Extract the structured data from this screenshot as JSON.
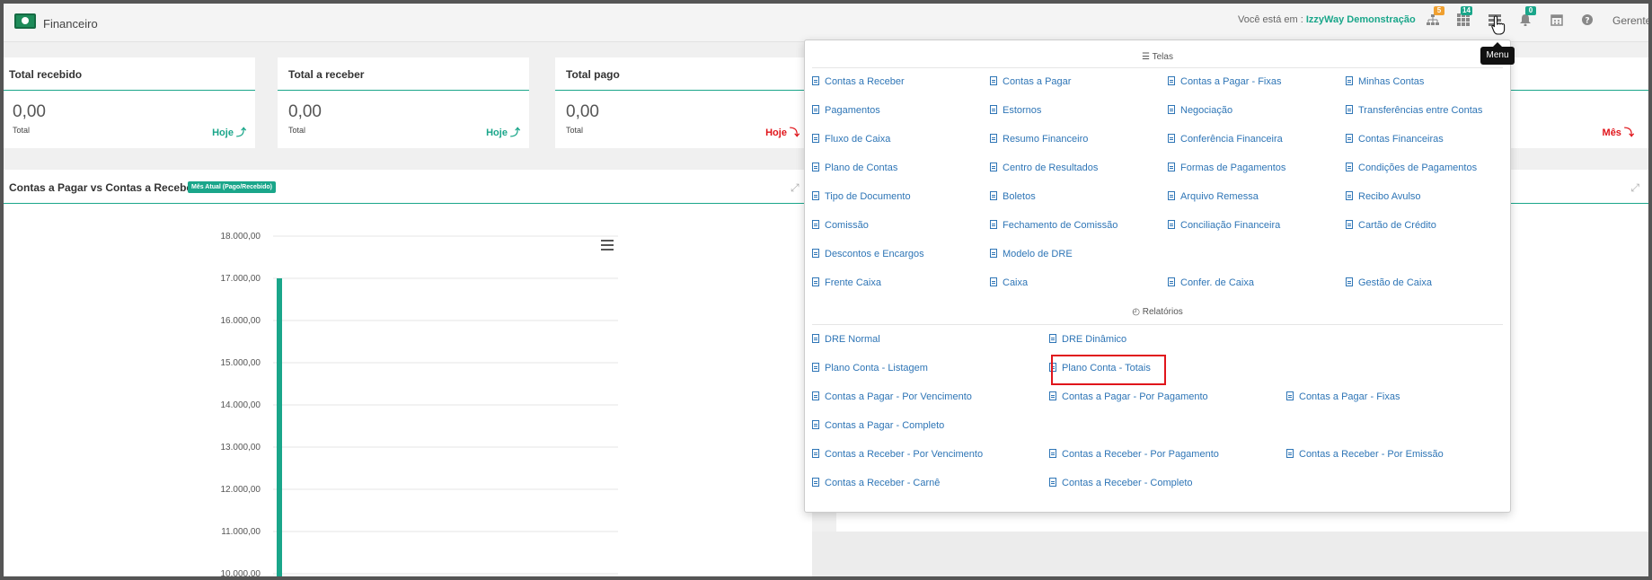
{
  "app": {
    "title": "Financeiro"
  },
  "header": {
    "you_are_prefix": "Você está em :",
    "company": "IzzyWay Demonstração",
    "badges": {
      "hierarchy": "5",
      "grid": "14",
      "bell": "0"
    },
    "user": "Gerente",
    "tooltip": "Menu"
  },
  "cards": [
    {
      "title": "Total recebido",
      "value": "0,00",
      "sub": "Total",
      "link": "Hoje ⤴",
      "link_color": "#1aa68a"
    },
    {
      "title": "Total a receber",
      "value": "0,00",
      "sub": "Total",
      "link": "Hoje ⤴",
      "link_color": "#1aa68a"
    },
    {
      "title": "Total pago",
      "value": "0,00",
      "sub": "Total",
      "link": "Hoje ⤵",
      "link_color": "#e0151b"
    },
    {
      "title": "",
      "value": "",
      "sub": "",
      "link": "Mês ⤵",
      "link_color": "#e0151b"
    }
  ],
  "chart_panel": {
    "title": "Contas a Pagar vs Contas a Receber",
    "tag": "Mês Atual (Pago/Recebido)"
  },
  "chart_data": {
    "type": "bar",
    "ylim": [
      10000,
      18000
    ],
    "yticks": [
      "18.000,00",
      "17.000,00",
      "16.000,00",
      "15.000,00",
      "14.000,00",
      "13.000,00",
      "12.000,00",
      "11.000,00",
      "10.000,00"
    ],
    "ytick_values": [
      18000,
      17000,
      16000,
      15000,
      14000,
      13000,
      12000,
      11000,
      10000
    ],
    "values": [
      17000
    ],
    "bar_color": "#1aa68a"
  },
  "menu": {
    "telas_title": "Telas",
    "telas": [
      [
        "Contas a Receber",
        "Contas a Pagar",
        "Contas a Pagar - Fixas",
        "Minhas Contas"
      ],
      [
        "Pagamentos",
        "Estornos",
        "Negociação",
        "Transferências entre Contas"
      ],
      [
        "Fluxo de Caixa",
        "Resumo Financeiro",
        "Conferência Financeira",
        "Contas Financeiras"
      ],
      [
        "Plano de Contas",
        "Centro de Resultados",
        "Formas de Pagamentos",
        "Condições de Pagamentos"
      ],
      [
        "Tipo de Documento",
        "Boletos",
        "Arquivo Remessa",
        "Recibo Avulso"
      ],
      [
        "Comissão",
        "Fechamento de Comissão",
        "Conciliação Financeira",
        "Cartão de Crédito"
      ],
      [
        "Descontos e Encargos",
        "Modelo de DRE",
        "",
        ""
      ],
      [
        "Frente Caixa",
        "Caixa",
        "Confer. de Caixa",
        "Gestão de Caixa"
      ]
    ],
    "relatorios_title": "Relatórios",
    "relatorios": [
      [
        "DRE Normal",
        "DRE Dinâmico",
        ""
      ],
      [
        "Plano Conta - Listagem",
        "Plano Conta - Totais",
        ""
      ],
      [
        "Contas a Pagar - Por Vencimento",
        "Contas a Pagar - Por Pagamento",
        "Contas a Pagar - Fixas"
      ],
      [
        "Contas a Pagar - Completo",
        "",
        ""
      ],
      [
        "Contas a Receber - Por Vencimento",
        "Contas a Receber - Por Pagamento",
        "Contas a Receber - Por Emissão"
      ],
      [
        "Contas a Receber - Carnê",
        "Contas a Receber - Completo",
        ""
      ]
    ]
  }
}
